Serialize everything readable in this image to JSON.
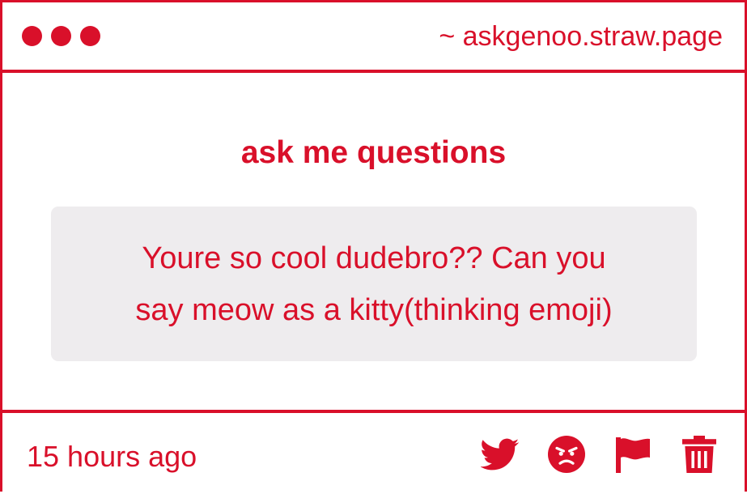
{
  "window": {
    "site_url": "~ askgenoo.straw.page",
    "dot_count": 3
  },
  "main": {
    "heading": "ask me questions",
    "question_line1": "Youre so cool dudebro?? Can you",
    "question_line2": "say meow as a kitty(thinking emoji)"
  },
  "footer": {
    "timestamp": "15 hours ago",
    "actions": [
      {
        "icon": "twitter-bird-icon"
      },
      {
        "icon": "angry-face-icon"
      },
      {
        "icon": "flag-icon"
      },
      {
        "icon": "trash-icon"
      }
    ]
  },
  "colors": {
    "accent": "#d9102a",
    "question_background": "#eeecee",
    "background": "#ffffff"
  }
}
